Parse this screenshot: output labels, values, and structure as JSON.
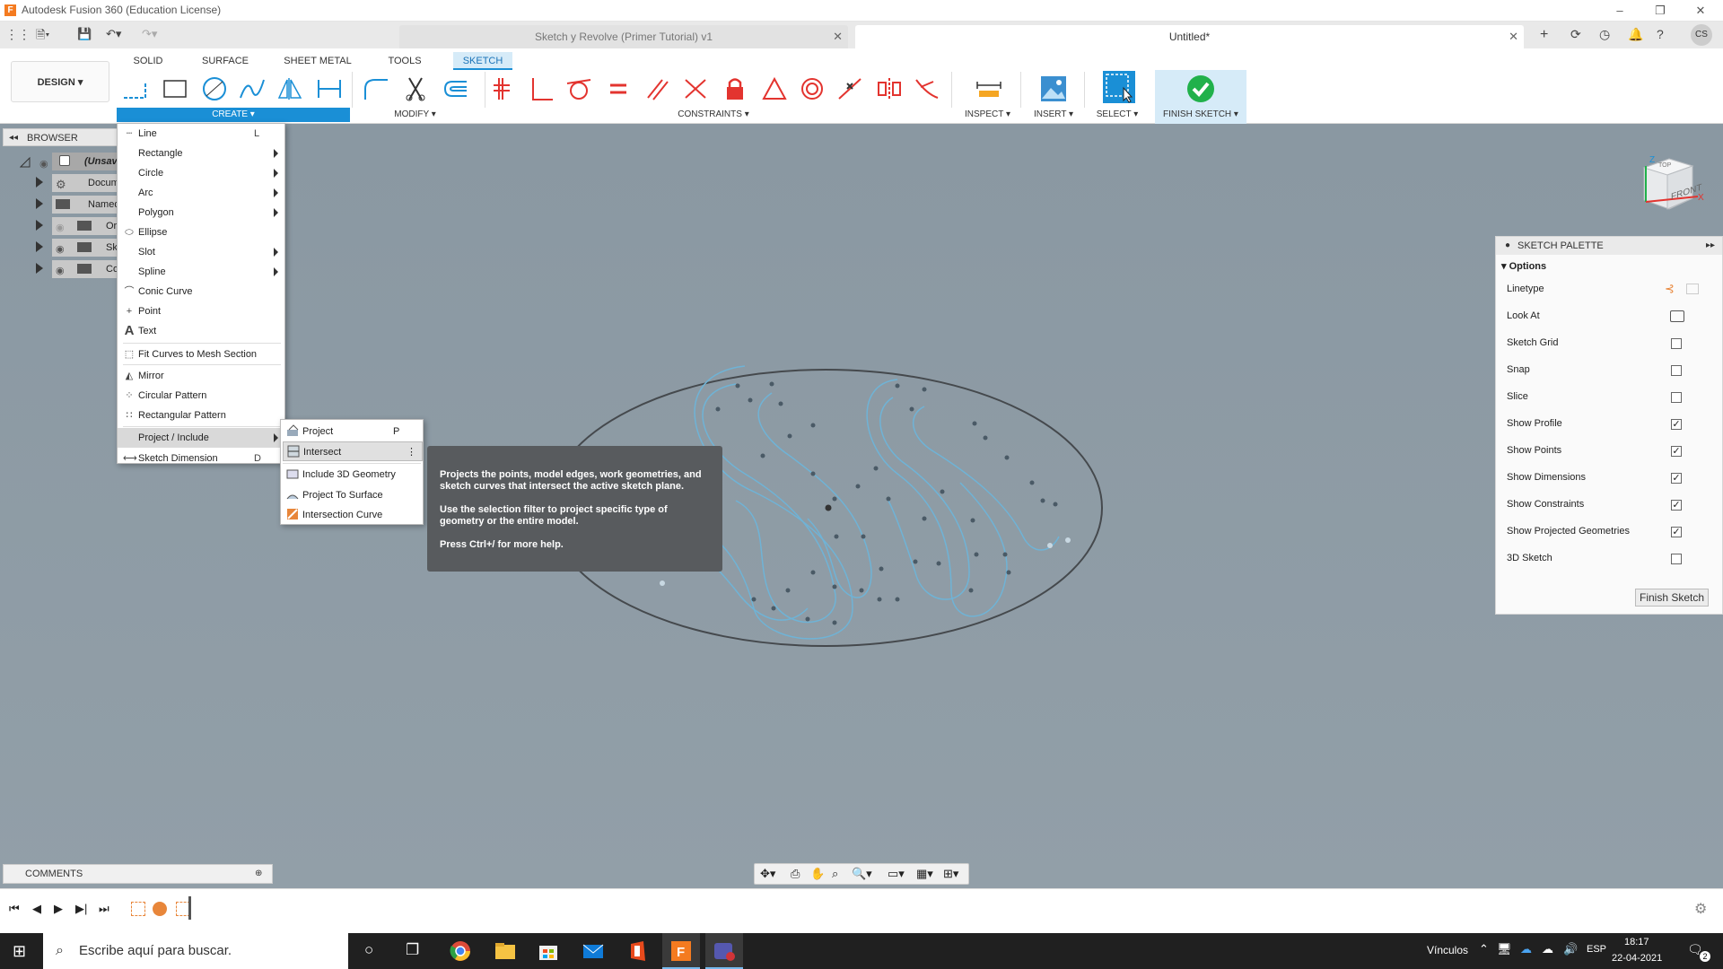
{
  "app": {
    "title": "Autodesk Fusion 360 (Education License)",
    "logo_letter": "F"
  },
  "tabs": [
    {
      "label": "Sketch y Revolve (Primer Tutorial) v1",
      "active": false
    },
    {
      "label": "Untitled*",
      "active": true
    }
  ],
  "user_initials": "CS",
  "workspace_tabs": [
    "SOLID",
    "SURFACE",
    "SHEET METAL",
    "TOOLS",
    "SKETCH"
  ],
  "design_button": "DESIGN ▾",
  "groups": {
    "create": "CREATE ▾",
    "modify": "MODIFY ▾",
    "constraints": "CONSTRAINTS ▾",
    "inspect": "INSPECT ▾",
    "insert": "INSERT ▾",
    "select": "SELECT ▾",
    "finish": "FINISH SKETCH ▾"
  },
  "browser": {
    "title": "BROWSER",
    "rows": [
      "(Unsaved)",
      "Document Settings",
      "Named Views",
      "Origin",
      "Sketches",
      "Construction"
    ]
  },
  "create_menu": [
    {
      "label": "Line",
      "shortcut": "L",
      "icon": "line-icon",
      "glyph": "┄"
    },
    {
      "label": "Rectangle",
      "submenu": true
    },
    {
      "label": "Circle",
      "submenu": true
    },
    {
      "label": "Arc",
      "submenu": true
    },
    {
      "label": "Polygon",
      "submenu": true
    },
    {
      "label": "Ellipse",
      "icon": "ellipse-icon",
      "glyph": "⬭"
    },
    {
      "label": "Slot",
      "submenu": true
    },
    {
      "label": "Spline",
      "submenu": true
    },
    {
      "label": "Conic Curve",
      "icon": "conic-icon",
      "glyph": "⌒"
    },
    {
      "label": "Point",
      "icon": "point-icon",
      "glyph": "+"
    },
    {
      "label": "Text",
      "icon": "text-icon",
      "glyph": "A"
    },
    {
      "label": "Fit Curves to Mesh Section",
      "icon": "fit-curves-icon",
      "glyph": "⬚"
    },
    {
      "label": "Mirror",
      "icon": "mirror-icon",
      "glyph": "◭"
    },
    {
      "label": "Circular Pattern",
      "icon": "circular-pattern-icon",
      "glyph": "⁘"
    },
    {
      "label": "Rectangular Pattern",
      "icon": "rectangular-pattern-icon",
      "glyph": "∷"
    },
    {
      "label": "Project / Include",
      "submenu": true,
      "highlight": true
    },
    {
      "label": "Sketch Dimension",
      "shortcut": "D",
      "icon": "dimension-icon",
      "glyph": "⟷"
    }
  ],
  "project_submenu": [
    {
      "label": "Project",
      "shortcut": "P"
    },
    {
      "label": "Intersect",
      "shortcut": "⋮",
      "highlight": true
    },
    {
      "label": "Include 3D Geometry"
    },
    {
      "label": "Project To Surface"
    },
    {
      "label": "Intersection Curve"
    }
  ],
  "tooltip": {
    "p1": "Projects the points, model edges, work geometries, and sketch curves that intersect the active sketch plane.",
    "p2": "Use the selection filter to project specific type of geometry or the entire model.",
    "p3": "Press Ctrl+/ for more help."
  },
  "viewcube": {
    "top": "TOP",
    "front": "FRONT",
    "z": "Z",
    "x": "X"
  },
  "palette": {
    "title": "SKETCH PALETTE",
    "section": "Options",
    "rows": [
      {
        "label": "Linetype",
        "type": "icons"
      },
      {
        "label": "Look At",
        "type": "icon"
      },
      {
        "label": "Sketch Grid",
        "checked": false
      },
      {
        "label": "Snap",
        "checked": false
      },
      {
        "label": "Slice",
        "checked": false
      },
      {
        "label": "Show Profile",
        "checked": true
      },
      {
        "label": "Show Points",
        "checked": true
      },
      {
        "label": "Show Dimensions",
        "checked": true
      },
      {
        "label": "Show Constraints",
        "checked": true
      },
      {
        "label": "Show Projected Geometries",
        "checked": true
      },
      {
        "label": "3D Sketch",
        "checked": false
      }
    ],
    "finish_button": "Finish Sketch"
  },
  "comments_label": "COMMENTS",
  "taskbar": {
    "search_placeholder": "Escribe aquí para buscar.",
    "links_label": "Vínculos",
    "language": "ESP",
    "time": "18:17",
    "date": "22-04-2021",
    "notifications": "2"
  },
  "colors": {
    "accent": "#1a8fd6",
    "sketch_line": "#6fb3d6",
    "finish_green": "#21b14b"
  }
}
